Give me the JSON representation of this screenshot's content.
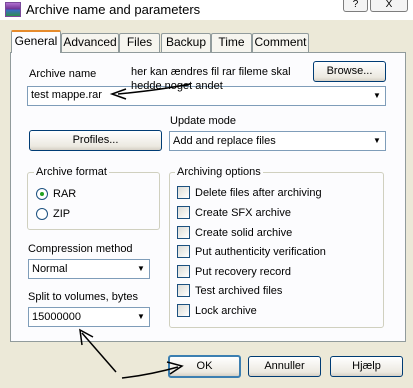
{
  "window": {
    "title": "Archive name and parameters",
    "help_glyph": "?",
    "close_glyph": "X"
  },
  "tabs": [
    {
      "label": "General"
    },
    {
      "label": "Advanced"
    },
    {
      "label": "Files"
    },
    {
      "label": "Backup"
    },
    {
      "label": "Time"
    },
    {
      "label": "Comment"
    }
  ],
  "archive_name": {
    "label": "Archive name",
    "value": "test mappe.rar",
    "browse_label": "Browse..."
  },
  "annotation": {
    "line1": "her kan ændres fil rar fileme skal",
    "line2": "hedde noget andet"
  },
  "update_mode": {
    "label": "Update mode",
    "value": "Add and replace files"
  },
  "profiles_label": "Profiles...",
  "archive_format": {
    "label": "Archive format",
    "options": [
      {
        "label": "RAR",
        "selected": true
      },
      {
        "label": "ZIP",
        "selected": false
      }
    ]
  },
  "compression": {
    "label": "Compression method",
    "value": "Normal"
  },
  "split": {
    "label": "Split to volumes, bytes",
    "value": "15000000"
  },
  "archiving_options": {
    "label": "Archiving options",
    "items": [
      {
        "label": "Delete files after archiving",
        "checked": false
      },
      {
        "label": "Create SFX archive",
        "checked": false
      },
      {
        "label": "Create solid archive",
        "checked": false
      },
      {
        "label": "Put authenticity verification",
        "checked": false
      },
      {
        "label": "Put recovery record",
        "checked": false
      },
      {
        "label": "Test archived files",
        "checked": false
      },
      {
        "label": "Lock archive",
        "checked": false
      }
    ]
  },
  "buttons": {
    "ok": "OK",
    "cancel": "Annuller",
    "help": "Hjælp"
  },
  "glyphs": {
    "dropdown_arrow": "▼"
  }
}
